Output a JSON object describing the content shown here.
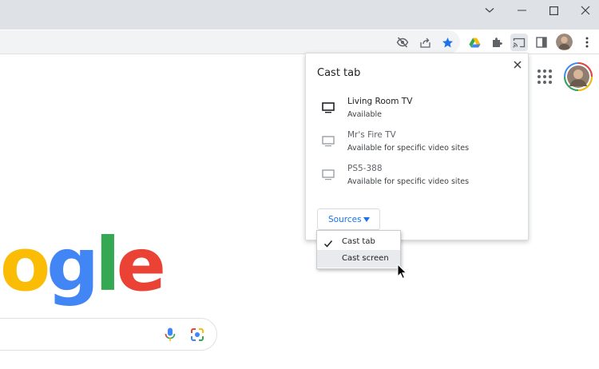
{
  "titlebar": {
    "icons": [
      "chevron-down-icon",
      "minimize-icon",
      "maximize-icon",
      "close-icon"
    ]
  },
  "toolbar": {
    "icons": [
      "eye-off-icon",
      "share-icon",
      "bookmark-star-icon",
      "google-drive-icon",
      "extensions-puzzle-icon",
      "cast-icon",
      "side-panel-icon",
      "profile-avatar",
      "more-vert-icon"
    ],
    "accent_color": "#1a73e8"
  },
  "page": {
    "logo_letters": [
      {
        "char": "o",
        "color": "#fbbc05"
      },
      {
        "char": "g",
        "color": "#4285f4"
      },
      {
        "char": "l",
        "color": "#34a853"
      },
      {
        "char": "e",
        "color": "#ea4335"
      }
    ]
  },
  "cast_dialog": {
    "title": "Cast tab",
    "sinks": [
      {
        "name": "Living Room TV",
        "status": "Available",
        "available": true
      },
      {
        "name": "Mr's Fire TV",
        "status": "Available for specific video sites",
        "available": false
      },
      {
        "name": "PS5-388",
        "status": "Available for specific video sites",
        "available": false
      }
    ],
    "sources_label": "Sources"
  },
  "sources_menu": {
    "items": [
      {
        "label": "Cast tab",
        "checked": true
      },
      {
        "label": "Cast screen",
        "checked": false,
        "hovered": true
      }
    ]
  }
}
